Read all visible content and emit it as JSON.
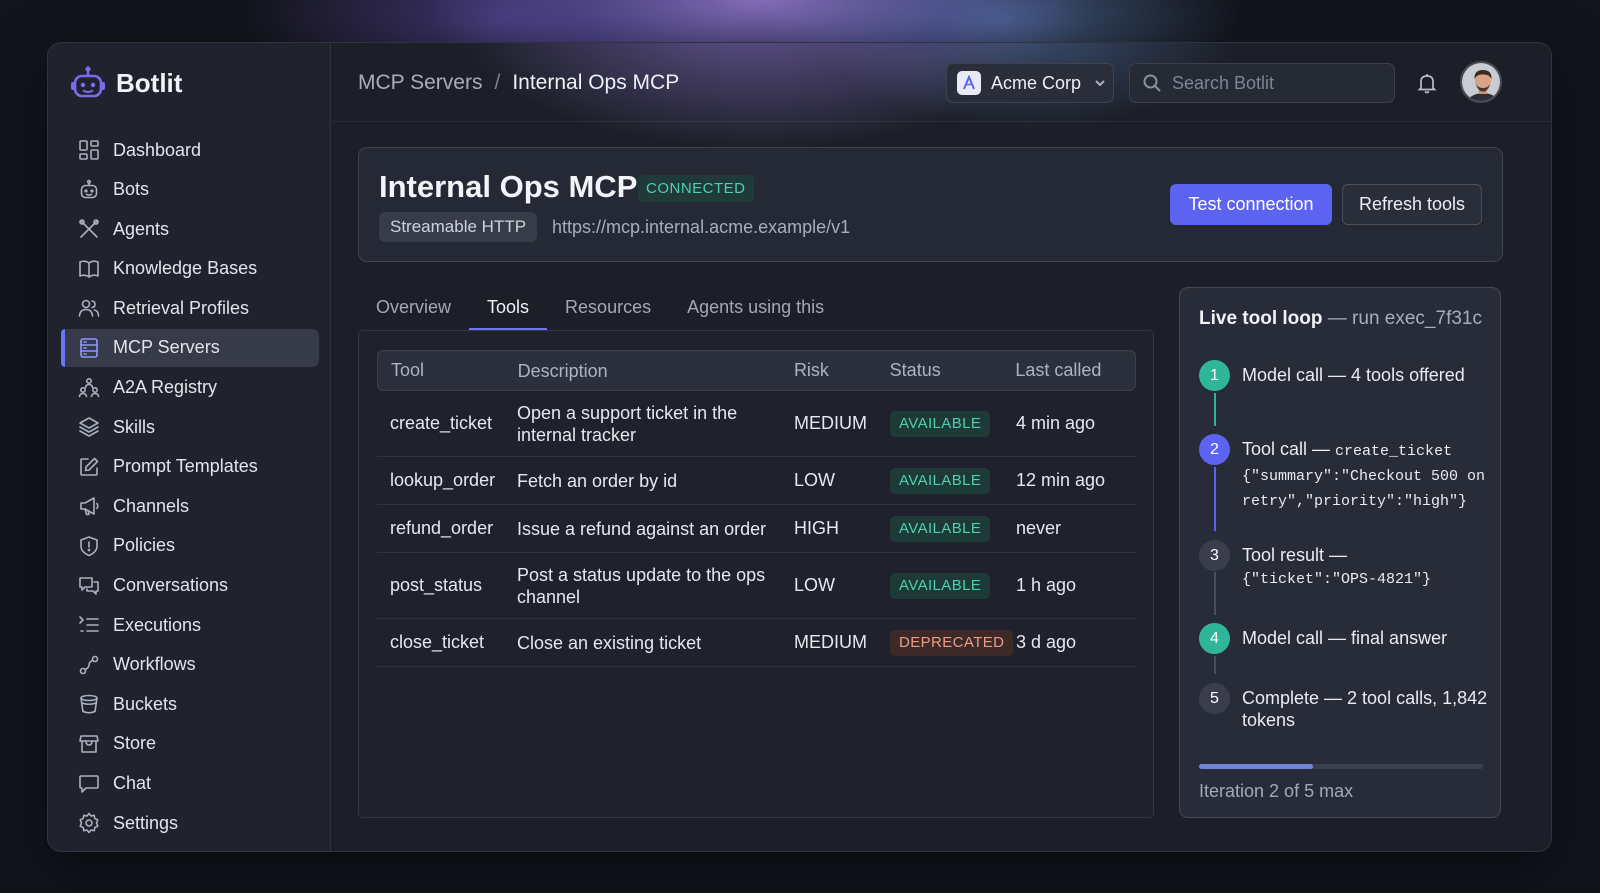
{
  "app": {
    "name": "Botlit"
  },
  "sidebar": {
    "items": [
      {
        "label": "Dashboard",
        "icon": "dashboard-icon"
      },
      {
        "label": "Bots",
        "icon": "bot-icon"
      },
      {
        "label": "Agents",
        "icon": "agents-icon"
      },
      {
        "label": "Knowledge Bases",
        "icon": "book-icon"
      },
      {
        "label": "Retrieval Profiles",
        "icon": "users-icon"
      },
      {
        "label": "MCP Servers",
        "icon": "server-icon",
        "active": true
      },
      {
        "label": "A2A Registry",
        "icon": "registry-icon"
      },
      {
        "label": "Skills",
        "icon": "layers-icon"
      },
      {
        "label": "Prompt Templates",
        "icon": "edit-icon"
      },
      {
        "label": "Channels",
        "icon": "megaphone-icon"
      },
      {
        "label": "Policies",
        "icon": "shield-icon"
      },
      {
        "label": "Conversations",
        "icon": "chat-bubbles-icon"
      },
      {
        "label": "Executions",
        "icon": "list-icon"
      },
      {
        "label": "Workflows",
        "icon": "workflow-icon"
      },
      {
        "label": "Buckets",
        "icon": "bucket-icon"
      },
      {
        "label": "Store",
        "icon": "store-icon"
      },
      {
        "label": "Chat",
        "icon": "chat-icon"
      },
      {
        "label": "Settings",
        "icon": "gear-icon"
      }
    ]
  },
  "header": {
    "breadcrumb": {
      "parent": "MCP Servers",
      "separator": "/",
      "current": "Internal Ops MCP"
    },
    "org": {
      "name": "Acme Corp"
    },
    "search": {
      "placeholder": "Search Botlit"
    }
  },
  "server": {
    "name": "Internal Ops MCP",
    "status": "CONNECTED",
    "transport": "Streamable HTTP",
    "url": "https://mcp.internal.acme.example/v1",
    "test_label": "Test connection",
    "refresh_label": "Refresh tools"
  },
  "tabs": [
    {
      "label": "Overview"
    },
    {
      "label": "Tools",
      "active": true
    },
    {
      "label": "Resources"
    },
    {
      "label": "Agents using this"
    }
  ],
  "tools_table": {
    "columns": [
      "Tool",
      "Description",
      "Risk",
      "Status",
      "Last called"
    ],
    "rows": [
      {
        "tool": "create_ticket",
        "description": "Open a support ticket in the internal tracker",
        "risk": "MEDIUM",
        "status": "AVAILABLE",
        "last_called": "4 min ago"
      },
      {
        "tool": "lookup_order",
        "description": "Fetch an order by id",
        "risk": "LOW",
        "status": "AVAILABLE",
        "last_called": "12 min ago"
      },
      {
        "tool": "refund_order",
        "description": "Issue a refund against an order",
        "risk": "HIGH",
        "status": "AVAILABLE",
        "last_called": "never"
      },
      {
        "tool": "post_status",
        "description": "Post a status update to the ops channel",
        "risk": "LOW",
        "status": "AVAILABLE",
        "last_called": "1 h ago"
      },
      {
        "tool": "close_ticket",
        "description": "Close an existing ticket",
        "risk": "MEDIUM",
        "status": "DEPRECATED",
        "last_called": "3 d ago"
      }
    ]
  },
  "loop": {
    "title": "Live tool loop",
    "run": "— run exec_7f31c",
    "steps": [
      {
        "num": "1",
        "text": "Model call — 4 tools offered",
        "state": "done"
      },
      {
        "num": "2",
        "text": "Tool call — ",
        "code": "create_ticket",
        "code2": "{\"summary\":\"Checkout 500 on retry\",\"priority\":\"high\"}",
        "state": "active"
      },
      {
        "num": "3",
        "text": "Tool result —",
        "code": "{\"ticket\":\"OPS-4821\"}",
        "state": "pending"
      },
      {
        "num": "4",
        "text": "Model call — final answer",
        "state": "done"
      },
      {
        "num": "5",
        "text": "Complete — 2 tool calls, 1,842 tokens",
        "state": "pending"
      }
    ],
    "progress": 0.4,
    "iteration_text": "Iteration 2 of 5 max"
  },
  "colors": {
    "accent": "#5b63f0",
    "available": "#4ed0b0",
    "deprecated": "#ec9d85",
    "step_done": "#2fb59a",
    "step_active": "#5b63f0",
    "step_pending": "#3a3e4c"
  }
}
